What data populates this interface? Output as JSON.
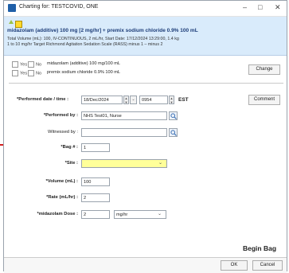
{
  "window": {
    "title": "Charting for: TESTCOVID, ONE",
    "minimize": "–",
    "maximize": "□",
    "close": "✕"
  },
  "order": {
    "title": "midazolam (additive) 100 mg [2 mg/hr] + premix sodium chloride 0.9% 100 mL",
    "detail1": "Total Volume (mL): 100, IV-CONTINUOUS, 2 mL/hr, Start Date: 17/12/2024 13:29:00, 1.4 kg",
    "detail2": "1 to 10 mg/hr Target Richmond Agitation Sedation Scale (RASS) minus 1 – minus 2"
  },
  "ingredients": [
    {
      "yes": "Yes",
      "no": "No",
      "name": "midazolam (additive) 100 mg/100 mL"
    },
    {
      "yes": "Yes",
      "no": "No",
      "name": "premix sodium chloride 0.9% 100 mL"
    }
  ],
  "buttons": {
    "change": "Change",
    "comment": "Comment",
    "ok": "OK",
    "cancel": "Cancel"
  },
  "form": {
    "performed_date_label": "*Performed date / time :",
    "date_value": "18/Dec/2024",
    "time_value": "0954",
    "timezone": "EST",
    "performed_by_label": "*Performed by :",
    "performed_by_value": "NHS Test01, Nurse",
    "witnessed_by_label": "Witnessed by :",
    "witnessed_by_value": "",
    "bag_label": "*Bag # :",
    "bag_value": "1",
    "site_label": "*Site :",
    "site_value": "",
    "volume_label": "*Volume (mL) :",
    "volume_value": "100",
    "rate_label": "*Rate (mL/hr) :",
    "rate_value": "2",
    "dose_label": "*midazolam Dose :",
    "dose_value": "2",
    "dose_unit": "mg/hr"
  },
  "action_title": "Begin Bag"
}
